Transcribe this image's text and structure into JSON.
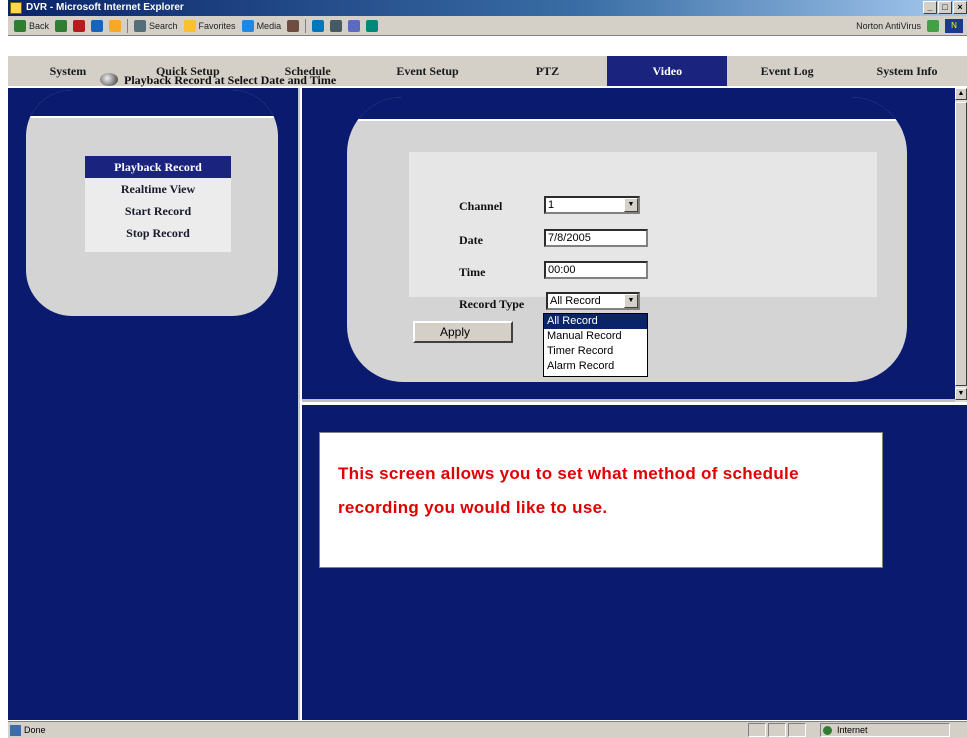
{
  "window": {
    "title": "DVR - Microsoft Internet Explorer",
    "controls": [
      "_",
      "□",
      "×"
    ]
  },
  "toolbar": {
    "back": "Back",
    "search": "Search",
    "favorites": "Favorites",
    "media": "Media",
    "norton": "Norton AntiVirus"
  },
  "nav": {
    "items": [
      "System",
      "Quick Setup",
      "Schedule",
      "Event Setup",
      "PTZ",
      "Video",
      "Event Log",
      "System Info"
    ],
    "active": "Video"
  },
  "sidebar": {
    "items": [
      {
        "label": "Playback Record",
        "selected": true
      },
      {
        "label": "Realtime View",
        "selected": false
      },
      {
        "label": "Start Record",
        "selected": false
      },
      {
        "label": "Stop Record",
        "selected": false
      }
    ]
  },
  "form": {
    "title": "Playback Record at Select Date and Time",
    "channel_label": "Channel",
    "channel_value": "1",
    "date_label": "Date",
    "date_value": "7/8/2005",
    "time_label": "Time",
    "time_value": "00:00",
    "record_type_label": "Record Type",
    "record_type_value": "All Record",
    "record_type_options": [
      "All Record",
      "Manual Record",
      "Timer Record",
      "Alarm Record"
    ],
    "apply_label": "Apply"
  },
  "note": {
    "text": "This screen allows you to set what method of schedule recording you would like to use."
  },
  "status": {
    "left": "Done",
    "zone": "Internet"
  },
  "colors": {
    "background_navy": "#0a1a6e",
    "active_tab": "#1a237e",
    "note_text": "#e00000"
  }
}
